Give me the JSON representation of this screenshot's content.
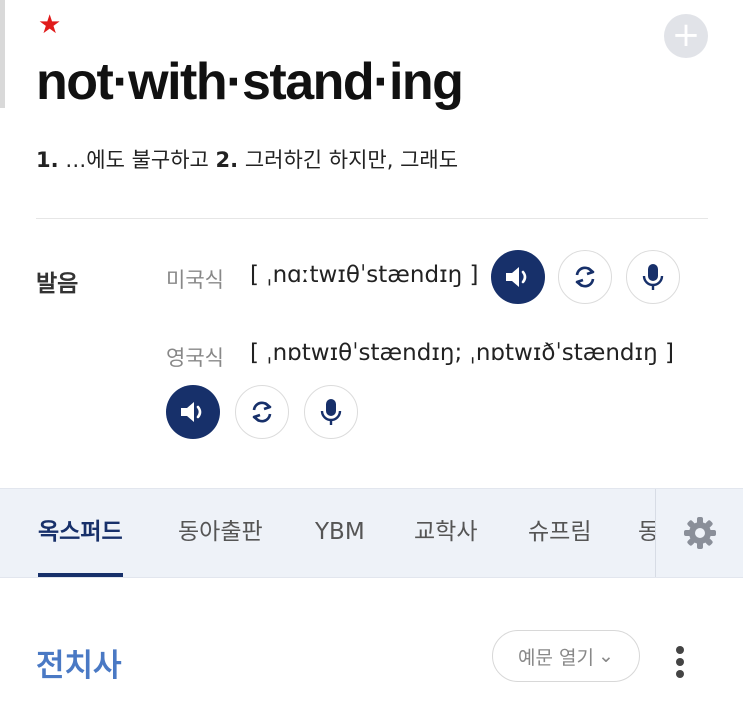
{
  "entry": {
    "star": "★",
    "headword": "not·with·stand·ing",
    "meanings": [
      {
        "num": "1.",
        "text": " …에도 불구하고 "
      },
      {
        "num": "2.",
        "text": " 그러하긴 하지만, 그래도"
      }
    ]
  },
  "pronunciation": {
    "label": "발음",
    "us": {
      "label": "미국식",
      "ipa": "[ ˌnɑːtwɪθˈstændɪŋ ]"
    },
    "uk": {
      "label": "영국식",
      "ipa": "[ ˌnɒtwɪθˈstændɪŋ; ˌnɒtwɪðˈstændɪŋ ]"
    }
  },
  "tabs": [
    "옥스퍼드",
    "동아출판",
    "YBM",
    "교학사",
    "슈프림",
    "동"
  ],
  "active_tab": "옥스퍼드",
  "section": {
    "pos_title": "전치사",
    "examples_button": "예문 열기",
    "examples_chevron": "⌄"
  },
  "icons": {
    "add": "plus-icon",
    "speaker": "speaker-icon",
    "repeat": "repeat-icon",
    "mic": "mic-icon",
    "settings": "gear-icon",
    "more": "more-vertical-icon"
  },
  "colors": {
    "primary": "#17306a",
    "star": "#e01b1b",
    "pos_title": "#4a79c4",
    "tabs_bg": "#eef2f8"
  }
}
